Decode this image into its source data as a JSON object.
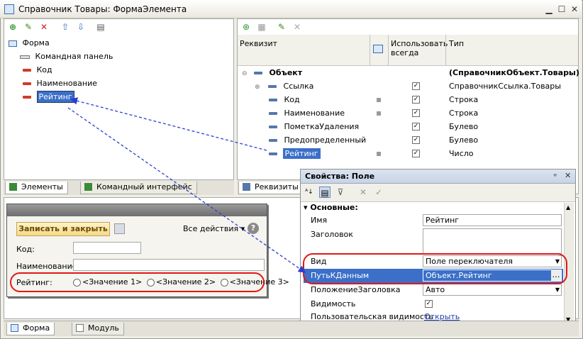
{
  "window": {
    "title": "Справочник Товары: ФормаЭлемента"
  },
  "left_tree": {
    "root": "Форма",
    "items": [
      {
        "label": "Командная панель"
      },
      {
        "label": "Код"
      },
      {
        "label": "Наименование"
      },
      {
        "label": "Рейтинг"
      }
    ],
    "tabs": [
      "Элементы",
      "Командный интерфейс"
    ]
  },
  "attributes": {
    "columns": {
      "name": "Реквизит",
      "use_always": "Использовать всегда",
      "type": "Тип"
    },
    "rows": [
      {
        "name": "Объект",
        "type": "(СправочникОбъект.Товары)"
      },
      {
        "name": "Ссылка",
        "type": "СправочникСсылка.Товары"
      },
      {
        "name": "Код",
        "type": "Строка"
      },
      {
        "name": "Наименование",
        "type": "Строка"
      },
      {
        "name": "ПометкаУдаления",
        "type": "Булево"
      },
      {
        "name": "Предопределенный",
        "type": "Булево"
      },
      {
        "name": "Рейтинг",
        "type": "Число"
      }
    ],
    "tab": "Реквизиты"
  },
  "form_preview": {
    "save_button": "Записать и закрыть",
    "all_actions": "Все действия ▾",
    "code_label": "Код:",
    "name_label": "Наименование:",
    "rating_label": "Рейтинг:",
    "options": [
      "<Значение 1>",
      "<Значение 2>",
      "<Значение 3>"
    ]
  },
  "properties": {
    "title": "Свойства: Поле",
    "section": "Основные:",
    "rows": {
      "name_label": "Имя",
      "name_value": "Рейтинг",
      "caption_label": "Заголовок",
      "kind_label": "Вид",
      "kind_value": "Поле переключателя",
      "path_label": "ПутьКДанным",
      "path_value": "Объект.Рейтинг",
      "title_pos_label": "ПоложениеЗаголовка",
      "title_pos_value": "Авто",
      "visible_label": "Видимость",
      "user_vis_label": "Пользовательская видимость",
      "user_vis_value": "Открыть"
    }
  },
  "bottom_tabs": [
    "Форма",
    "Модуль"
  ],
  "colors": {
    "accent_red": "#e01818",
    "link_blue": "#1f3fa8",
    "arrow_blue": "#2a3fd0",
    "selection": "#3b6fc8"
  }
}
